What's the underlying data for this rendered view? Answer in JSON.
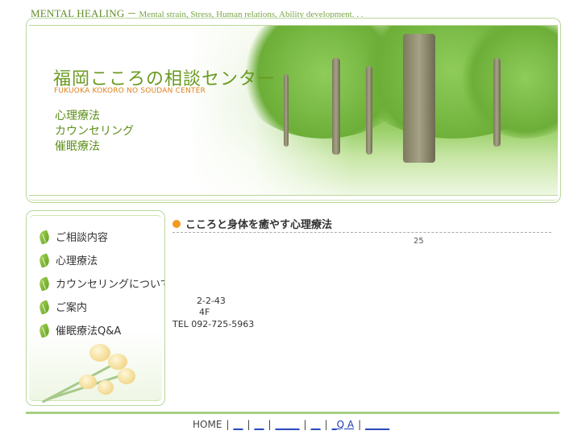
{
  "topline": {
    "brand": "MENTAL HEALING",
    "dash": "－",
    "tagline": "Mental strain, Stress, Human relations, Ability development. . ."
  },
  "header": {
    "title_jp": "福岡こころの相談センター",
    "title_en": "FUKUOKA KOKORO NO SOUDAN CENTER",
    "services": [
      "心理療法",
      "カウンセリング",
      "催眠療法"
    ]
  },
  "sidebar": {
    "items": [
      {
        "label": "ご相談内容"
      },
      {
        "label": "心理療法"
      },
      {
        "label": "カウンセリングについて"
      },
      {
        "label": "ご案内"
      },
      {
        "label": "催眠療法Q&A"
      }
    ]
  },
  "main": {
    "heading": "こころと身体を癒やす心理療法",
    "number": "25",
    "address_line1": "2-2-43",
    "address_line2": "4F",
    "tel": "TEL 092-725-5963"
  },
  "footer": {
    "home": "HOME",
    "sep": "|",
    "links": [
      "__",
      "__",
      "_____",
      "__",
      "_Q A",
      "_____"
    ]
  },
  "colors": {
    "accent_green": "#6a9a1f",
    "orange": "#f29a1f",
    "border_green": "#b9d79a",
    "link_blue": "#1a3cb8"
  }
}
